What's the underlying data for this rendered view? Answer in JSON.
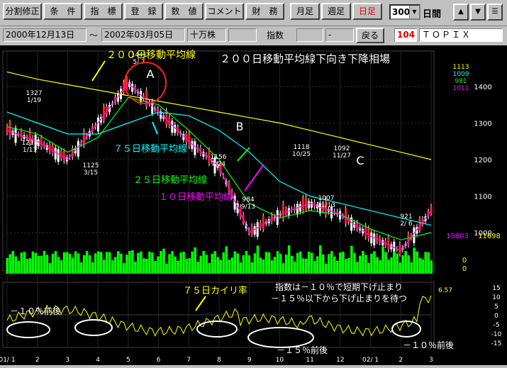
{
  "toolbar": {
    "buttons": [
      "分割修正",
      "条　件",
      "指　標",
      "登　録",
      "数　値",
      "コメント",
      "財　務",
      "月足",
      "週足",
      "日足"
    ],
    "period_value": "300",
    "period_unit": "日間",
    "up_label": "▲",
    "down_label": "▼",
    "menu_label": "☰"
  },
  "infobar": {
    "start_date": "2000年12月13日",
    "tilde": "～",
    "end_date": "2002年03月05日",
    "unit": "十万株",
    "index_label": "指数",
    "dash": "-",
    "back_label": "戻る",
    "code": "104",
    "name": "ＴＯＰＩＸ"
  },
  "chart_data": {
    "type": "line",
    "title": "２００日移動平均線下向き下降相場",
    "y_ticks": [
      1400,
      1300,
      1200,
      1100,
      1000
    ],
    "legend_values": [
      "1113",
      "1009",
      "981",
      "1011"
    ],
    "x_ticks": [
      "01/ 1",
      "2",
      "3",
      "4",
      "5",
      "6",
      "7",
      "8",
      "9",
      "10",
      "11",
      "12",
      "02/ 1",
      "2",
      "3"
    ],
    "price_annotations": [
      {
        "date": "1/19",
        "value": "1327"
      },
      {
        "date": "1/11",
        "value": "1218"
      },
      {
        "date": "3/15",
        "value": "1125"
      },
      {
        "date": "5/ 7",
        "value": "1441"
      },
      {
        "date": "7/24",
        "value": "1156"
      },
      {
        "date": "9/13",
        "value": "984"
      },
      {
        "date": "10/25",
        "value": "1118"
      },
      {
        "date": "11/13",
        "value": "1007"
      },
      {
        "date": "11/27",
        "value": "1092"
      },
      {
        "date": "2/ 6",
        "value": "921"
      }
    ],
    "series": [
      {
        "name": "２００日移動平均線",
        "color": "#ffff00",
        "values": [
          1440,
          1420,
          1405,
          1390,
          1375,
          1360,
          1345,
          1330,
          1315,
          1300,
          1280,
          1260,
          1240,
          1220,
          1200
        ]
      },
      {
        "name": "７５日移動平均線",
        "color": "#00ffff",
        "values": [
          1330,
          1300,
          1270,
          1270,
          1300,
          1330,
          1320,
          1280,
          1220,
          1140,
          1100,
          1080,
          1060,
          1040,
          1020
        ]
      },
      {
        "name": "２５日移動平均線",
        "color": "#00ff00",
        "values": [
          1290,
          1270,
          1220,
          1260,
          1370,
          1350,
          1280,
          1200,
          1080,
          1040,
          1060,
          1050,
          1010,
          980,
          1000
        ]
      },
      {
        "name": "１０日移動平均線",
        "color": "#ff00ff",
        "values": [
          1280,
          1250,
          1200,
          1300,
          1410,
          1330,
          1250,
          1180,
          1000,
          1050,
          1080,
          1050,
          990,
          950,
          1060
        ]
      }
    ],
    "volume_labels": [
      "19803",
      "11698",
      "0",
      "0"
    ],
    "deviation": {
      "label": "７５日カイリ率",
      "value_label": "6.57",
      "y_ticks": [
        "15",
        "10",
        "5",
        "0",
        "-5",
        "-10",
        "-15"
      ]
    },
    "annotations": {
      "ma200": "２００日移動平均線",
      "ma75": "７５日移動平均線",
      "ma25": "２５日移動平均線",
      "ma10": "１０日移動平均線",
      "point_a": "A",
      "point_b": "B",
      "point_c": "C",
      "note1": "指数は－１０％で短期下げ止まり",
      "note2": "－１５％以下から下げ止まりを待つ",
      "around10_left": "－１０％前後",
      "around15": "－１５％前後",
      "around10_right": "－１０％前後"
    }
  }
}
